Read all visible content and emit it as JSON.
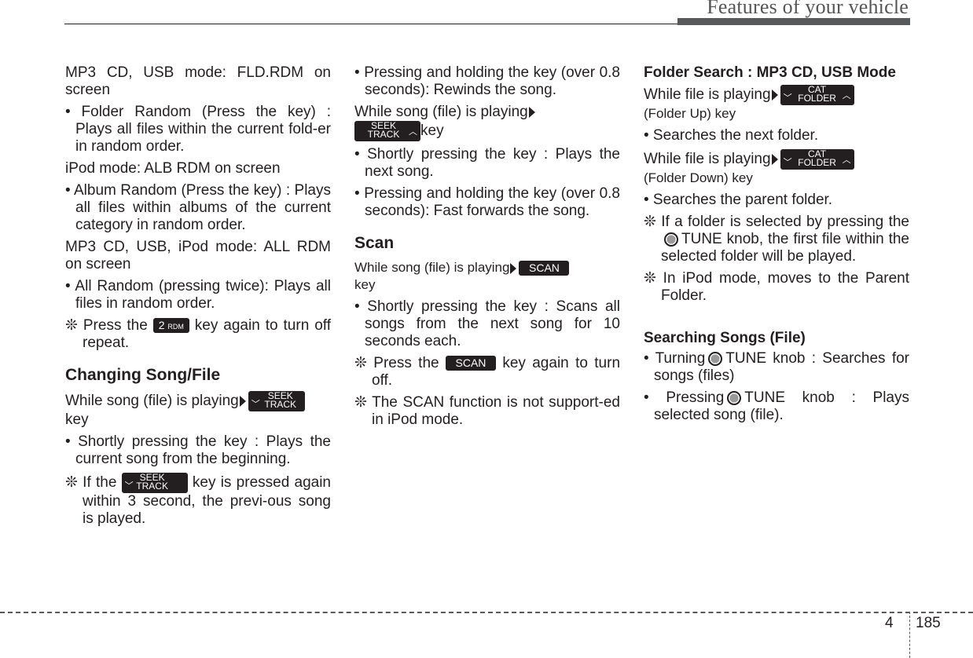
{
  "header": {
    "title": "Features of your vehicle"
  },
  "keys": {
    "seek": "SEEK",
    "track": "TRACK",
    "cat": "CAT",
    "folder": "FOLDER",
    "scan": "SCAN",
    "rdm_num": "2",
    "rdm": "RDM",
    "down": "﹀",
    "up": "︿"
  },
  "col1": {
    "p1": "MP3 CD, USB mode: FLD.RDM on screen",
    "b1": "• Folder Random (Press the key) : Plays all files within the current fold-er in random order.",
    "p2": "iPod mode: ALB RDM on screen",
    "b2": "• Album Random (Press the key) : Plays all files within albums of the current category in random order.",
    "p3": "MP3 CD, USB, iPod mode: ALL RDM on screen",
    "b3": "• All Random (pressing twice): Plays all files in random order.",
    "n1_pre": "❊ Press the",
    "n1_post": "key again to turn off repeat.",
    "h_changing": "Changing Song/File",
    "p4_pre": "While song (file) is playing",
    "p4_post": "key",
    "b4": "• Shortly pressing the key : Plays the current song from the beginning.",
    "n2_pre": "❊ If the",
    "n2_post": "key is pressed again within 3 second, the previ-ous song is played."
  },
  "col2": {
    "b1": "• Pressing and holding the key (over 0.8 seconds): Rewinds the song.",
    "p1_pre": "While song (file) is playing",
    "p1_post": "key",
    "b2": "• Shortly pressing the key : Plays the next song.",
    "b3": "• Pressing and holding the key (over 0.8 seconds): Fast forwards the song.",
    "h_scan": "Scan",
    "p2_pre": "While song (file) is playing",
    "p2_post": "key",
    "b4": "• Shortly pressing the key : Scans all songs from the next song for 10 seconds each.",
    "n1_pre": "❊ Press the",
    "n1_post": "key again to turn off.",
    "n2": "❊ The SCAN function is not support-ed in iPod mode."
  },
  "col3": {
    "h_folder": "Folder Search : MP3 CD, USB Mode",
    "p1_pre": "While file is playing",
    "p1_post": "(Folder Up) key",
    "b1": "• Searches the next folder.",
    "p2_pre": "While file is playing",
    "p2_post": "(Folder Down) key",
    "b2": "• Searches the parent folder.",
    "n1_pre": "❊ If a folder is selected by pressing the",
    "n1_post": "TUNE knob, the first file within the selected folder will be played.",
    "n2": "❊ In iPod mode, moves to the Parent Folder.",
    "h_search": "Searching Songs (File)",
    "b3_pre": "• Turning",
    "b3_post": "TUNE knob : Searches for songs (files)",
    "b4_pre": "• Pressing",
    "b4_post": "TUNE knob : Plays selected song (file)."
  },
  "footer": {
    "section": "4",
    "page": "185"
  }
}
